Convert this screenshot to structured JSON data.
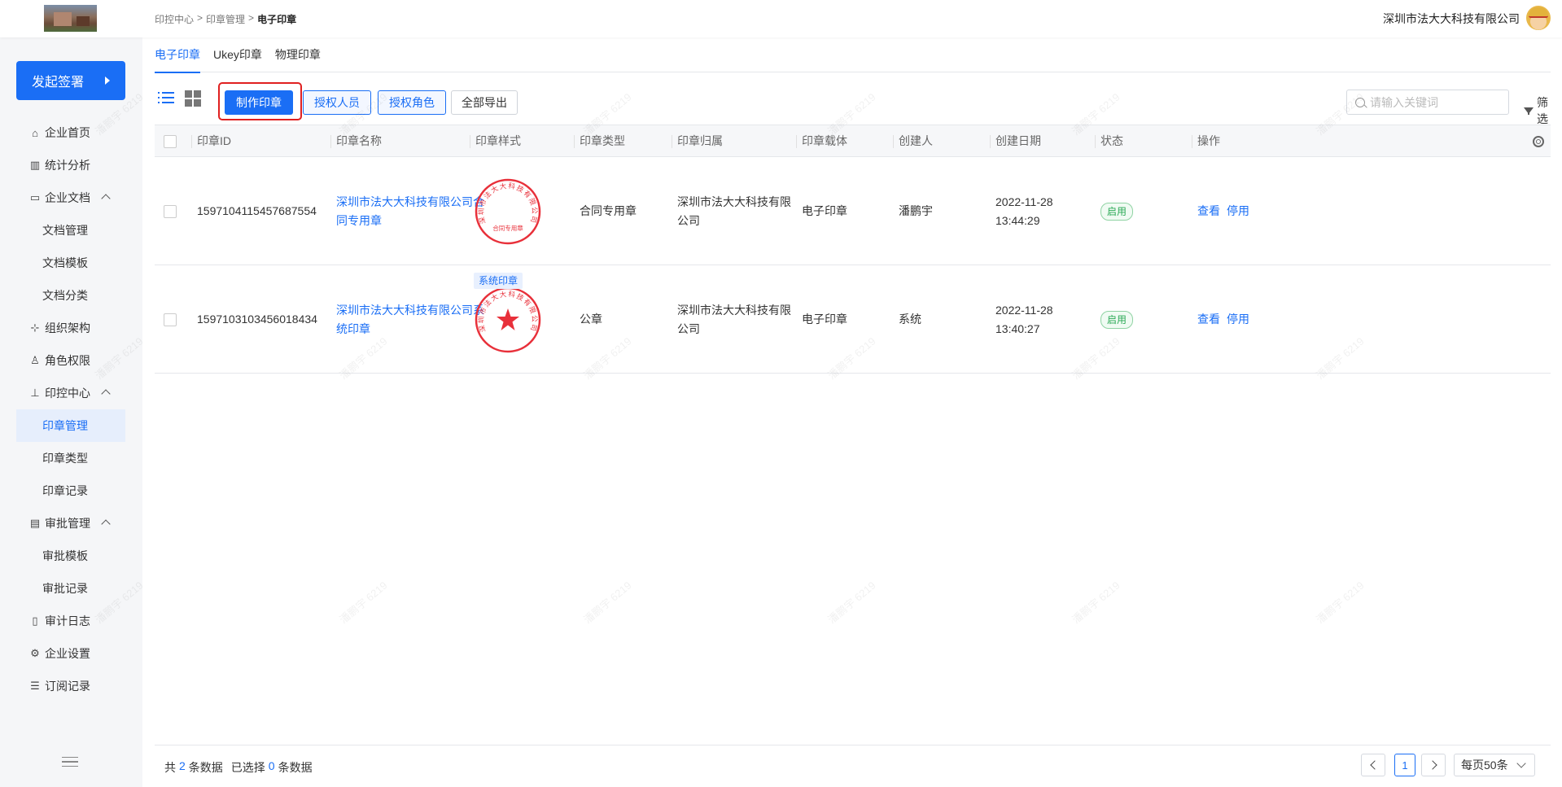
{
  "header": {
    "breadcrumb": [
      "印控中心",
      ">",
      "印章管理",
      ">",
      "电子印章"
    ],
    "company": "深圳市法大大科技有限公司"
  },
  "sidebar": {
    "start_button": "发起签署",
    "items": [
      {
        "label": "企业首页",
        "icon": "home-icon",
        "level": "top"
      },
      {
        "label": "统计分析",
        "icon": "chart-icon",
        "level": "top"
      },
      {
        "label": "企业文档",
        "icon": "folder-icon",
        "level": "top",
        "expanded": true
      },
      {
        "label": "文档管理",
        "level": "sub"
      },
      {
        "label": "文档模板",
        "level": "sub"
      },
      {
        "label": "文档分类",
        "level": "sub"
      },
      {
        "label": "组织架构",
        "icon": "org-icon",
        "level": "top"
      },
      {
        "label": "角色权限",
        "icon": "role-icon",
        "level": "top"
      },
      {
        "label": "印控中心",
        "icon": "stamp-icon",
        "level": "top",
        "expanded": true
      },
      {
        "label": "印章管理",
        "level": "sub",
        "active": true
      },
      {
        "label": "印章类型",
        "level": "sub"
      },
      {
        "label": "印章记录",
        "level": "sub"
      },
      {
        "label": "审批管理",
        "icon": "clipboard-icon",
        "level": "top",
        "expanded": true
      },
      {
        "label": "审批模板",
        "level": "sub"
      },
      {
        "label": "审批记录",
        "level": "sub"
      },
      {
        "label": "审计日志",
        "icon": "book-icon",
        "level": "top"
      },
      {
        "label": "企业设置",
        "icon": "gear-icon",
        "level": "top"
      },
      {
        "label": "订阅记录",
        "icon": "doc-list-icon",
        "level": "top"
      }
    ]
  },
  "tabs": [
    {
      "label": "电子印章",
      "active": true
    },
    {
      "label": "Ukey印章"
    },
    {
      "label": "物理印章"
    }
  ],
  "toolbar": {
    "make_seal": "制作印章",
    "auth_person": "授权人员",
    "auth_role": "授权角色",
    "export_all": "全部导出",
    "search_placeholder": "请输入关键词",
    "filter": "筛选"
  },
  "table": {
    "columns": [
      "印章ID",
      "印章名称",
      "印章样式",
      "印章类型",
      "印章归属",
      "印章载体",
      "创建人",
      "创建日期",
      "状态",
      "操作"
    ],
    "rows": [
      {
        "id": "1597104115457687554",
        "name": "深圳市法大大科技有限公司合同专用章",
        "seal_style": {
          "ring_text": "深圳市法大大科技有限公司",
          "center_text": "合同专用章",
          "has_star": false,
          "tag": ""
        },
        "type": "合同专用章",
        "owner": "深圳市法大大科技有限公司",
        "carrier": "电子印章",
        "creator": "潘鹏宇",
        "date": "2022-11-28",
        "time": "13:44:29",
        "status": "启用",
        "ops": [
          "查看",
          "停用"
        ]
      },
      {
        "id": "1597103103456018434",
        "name": "深圳市法大大科技有限公司系统印章",
        "seal_style": {
          "ring_text": "深圳市法大大科技有限公司",
          "center_text": "",
          "has_star": true,
          "tag": "系统印章"
        },
        "type": "公章",
        "owner": "深圳市法大大科技有限公司",
        "carrier": "电子印章",
        "creator": "系统",
        "date": "2022-11-28",
        "time": "13:40:27",
        "status": "启用",
        "ops": [
          "查看",
          "停用"
        ]
      }
    ]
  },
  "footer": {
    "total_prefix": "共",
    "total_count": "2",
    "total_suffix": "条数据",
    "selected_prefix": "已选择",
    "selected_count": "0",
    "selected_suffix": "条数据",
    "current_page": "1",
    "page_size": "每页50条"
  },
  "watermark": "潘鹏宇 6219",
  "colors": {
    "primary": "#1a6ef5",
    "highlight": "#e02020",
    "success": "#2aa955",
    "seal_red": "#e8303a"
  }
}
